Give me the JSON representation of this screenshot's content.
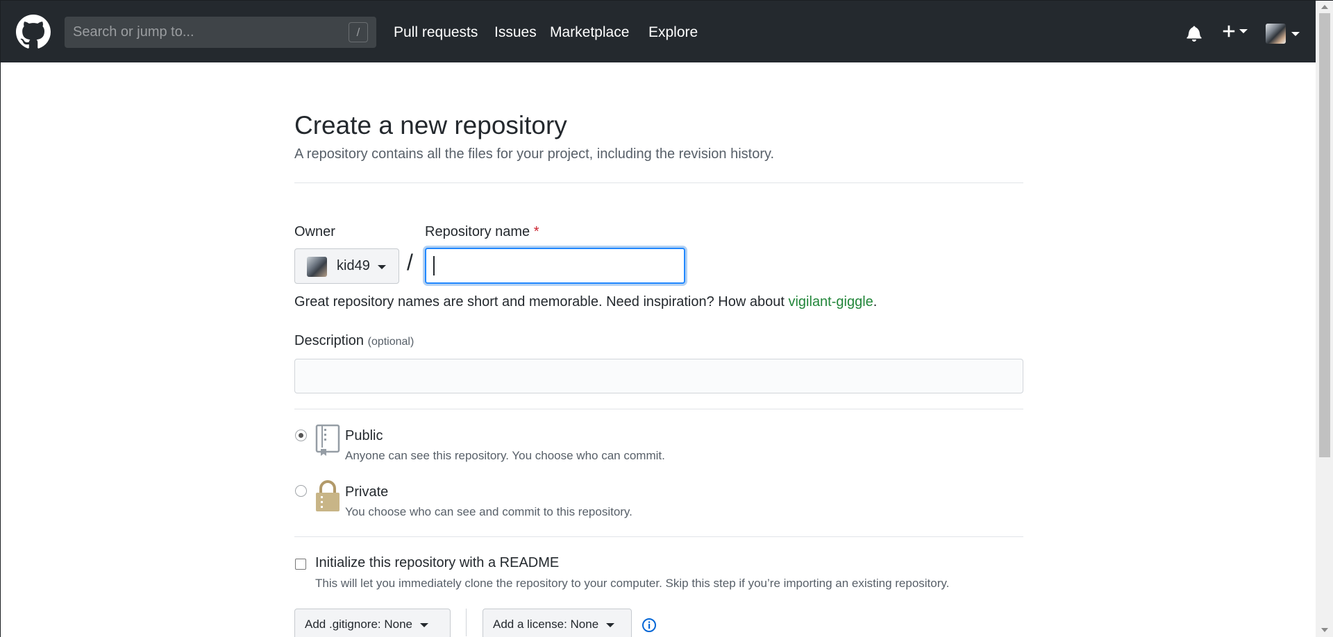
{
  "header": {
    "search_placeholder": "Search or jump to...",
    "search_shortcut": "/",
    "nav": [
      "Pull requests",
      "Issues",
      "Marketplace",
      "Explore"
    ]
  },
  "page": {
    "title": "Create a new repository",
    "subtitle": "A repository contains all the files for your project, including the revision history."
  },
  "form": {
    "owner_label": "Owner",
    "owner_name": "kid49",
    "repo_label": "Repository name",
    "required_mark": "*",
    "separator": "/",
    "repo_value": "",
    "hint_prefix": "Great repository names are short and memorable. Need inspiration? How about ",
    "hint_suggestion": "vigilant-giggle",
    "hint_suffix": ".",
    "description_label": "Description",
    "description_optional": "(optional)",
    "description_value": ""
  },
  "visibility": {
    "public": {
      "title": "Public",
      "desc": "Anyone can see this repository. You choose who can commit.",
      "selected": true
    },
    "private": {
      "title": "Private",
      "desc": "You choose who can see and commit to this repository.",
      "selected": false
    }
  },
  "init": {
    "readme_title": "Initialize this repository with a README",
    "readme_desc": "This will let you immediately clone the repository to your computer. Skip this step if you’re importing an existing repository.",
    "gitignore_label": "Add .gitignore:",
    "gitignore_value": "None",
    "license_label": "Add a license:",
    "license_value": "None"
  },
  "colors": {
    "header_bg": "#24292e",
    "focus_blue": "#2188ff",
    "suggestion_green": "#22863a",
    "required_red": "#cb2431"
  },
  "icons": [
    "github-logo-icon",
    "bell-icon",
    "plus-icon",
    "avatar",
    "repo-icon",
    "lock-icon",
    "info-icon"
  ]
}
